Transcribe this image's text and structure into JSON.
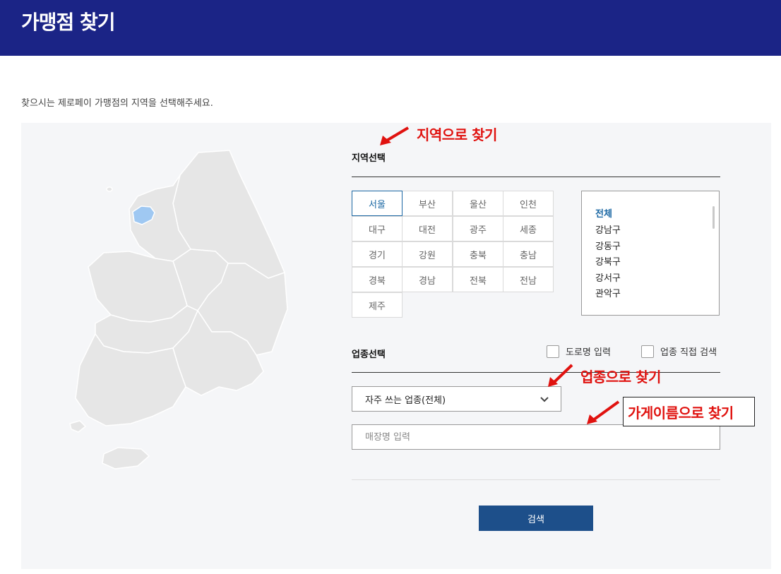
{
  "header": {
    "title": "가맹점 찾기",
    "background": "#1b2486"
  },
  "intro": "찾으시는 제로페이 가맹점의 지역을 선택해주세요.",
  "region_section": {
    "title": "지역선택",
    "regions": [
      "서울",
      "부산",
      "울산",
      "인천",
      "대구",
      "대전",
      "광주",
      "세종",
      "경기",
      "강원",
      "충북",
      "충남",
      "경북",
      "경남",
      "전북",
      "전남",
      "제주"
    ],
    "selected": "서울"
  },
  "districts": {
    "items": [
      "전체",
      "강남구",
      "강동구",
      "강북구",
      "강서구",
      "관악구"
    ],
    "selected": "전체"
  },
  "category_section": {
    "title": "업종선택",
    "road_name_checkbox": "도로명 입력",
    "direct_search_checkbox": "업종 직접 검색",
    "category_select_value": "자주 쓰는 업종(전체)",
    "store_name_placeholder": "매장명 입력",
    "search_button": "검색"
  },
  "annotations": {
    "by_region": "지역으로 찾기",
    "by_category": "업종으로 찾기",
    "by_store_name": "가게이름으로 찾기",
    "color": "#e0120f"
  },
  "colors": {
    "accent": "#1a67a3",
    "button": "#1d4f8a",
    "map_fill": "#e6e6e6",
    "map_selected": "#9fc8f2"
  },
  "icons": {
    "select": "chevron-down-icon",
    "annotation": "red-arrow-icon"
  }
}
